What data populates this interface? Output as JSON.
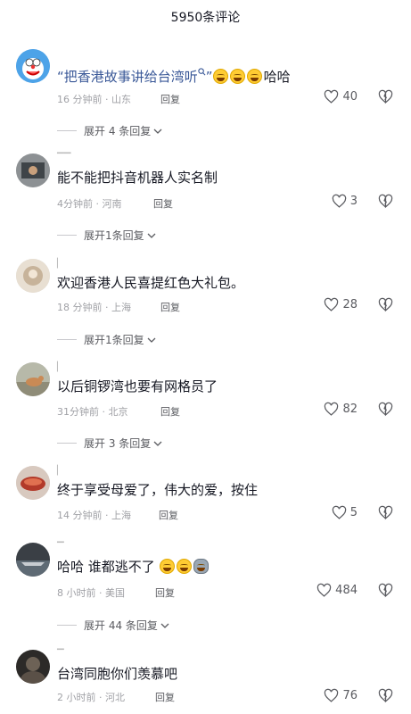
{
  "header": {
    "title": "5950条评论"
  },
  "comments": [
    {
      "text_quote": "“把香港故事讲给台湾听",
      "text_quote_end": "”",
      "text_suffix": "哈哈",
      "time": "16 分钟前",
      "location": "山东",
      "reply": "回复",
      "likes": "40",
      "expand": "展开 4 条回复"
    },
    {
      "text": "能不能把抖音机器人实名制",
      "time": "4分钟前",
      "location": "河南",
      "reply": "回复",
      "likes": "3",
      "expand": "展开1条回复"
    },
    {
      "text": "欢迎香港人民喜提红色大礼包。",
      "time": "18 分钟前",
      "location": "上海",
      "reply": "回复",
      "likes": "28",
      "expand": "展开1条回复"
    },
    {
      "text": "以后铜锣湾也要有网格员了",
      "time": "31分钟前",
      "location": "北京",
      "reply": "回复",
      "likes": "82",
      "expand": "展开 3 条回复"
    },
    {
      "text": "终于享受母爱了，伟大的爱，按住",
      "time": "14 分钟前",
      "location": "上海",
      "reply": "回复",
      "likes": "5",
      "expand": ""
    },
    {
      "text": "哈哈 谁都逃不了",
      "time": "8 小时前",
      "location": "美国",
      "reply": "回复",
      "likes": "484",
      "expand": "展开 44 条回复"
    },
    {
      "text": "台湾同胞你们羡慕吧",
      "time": "2 小时前",
      "location": "河北",
      "reply": "回复",
      "likes": "76",
      "expand": ""
    }
  ],
  "icons": {
    "like": "heart-outline-icon",
    "dislike": "broken-heart-icon",
    "expand": "chevron-down-icon",
    "search": "search-small-icon",
    "laugh": "laughing-emoji-icon",
    "grin": "grinning-emoji-icon",
    "cat": "cat-emoji-icon"
  }
}
